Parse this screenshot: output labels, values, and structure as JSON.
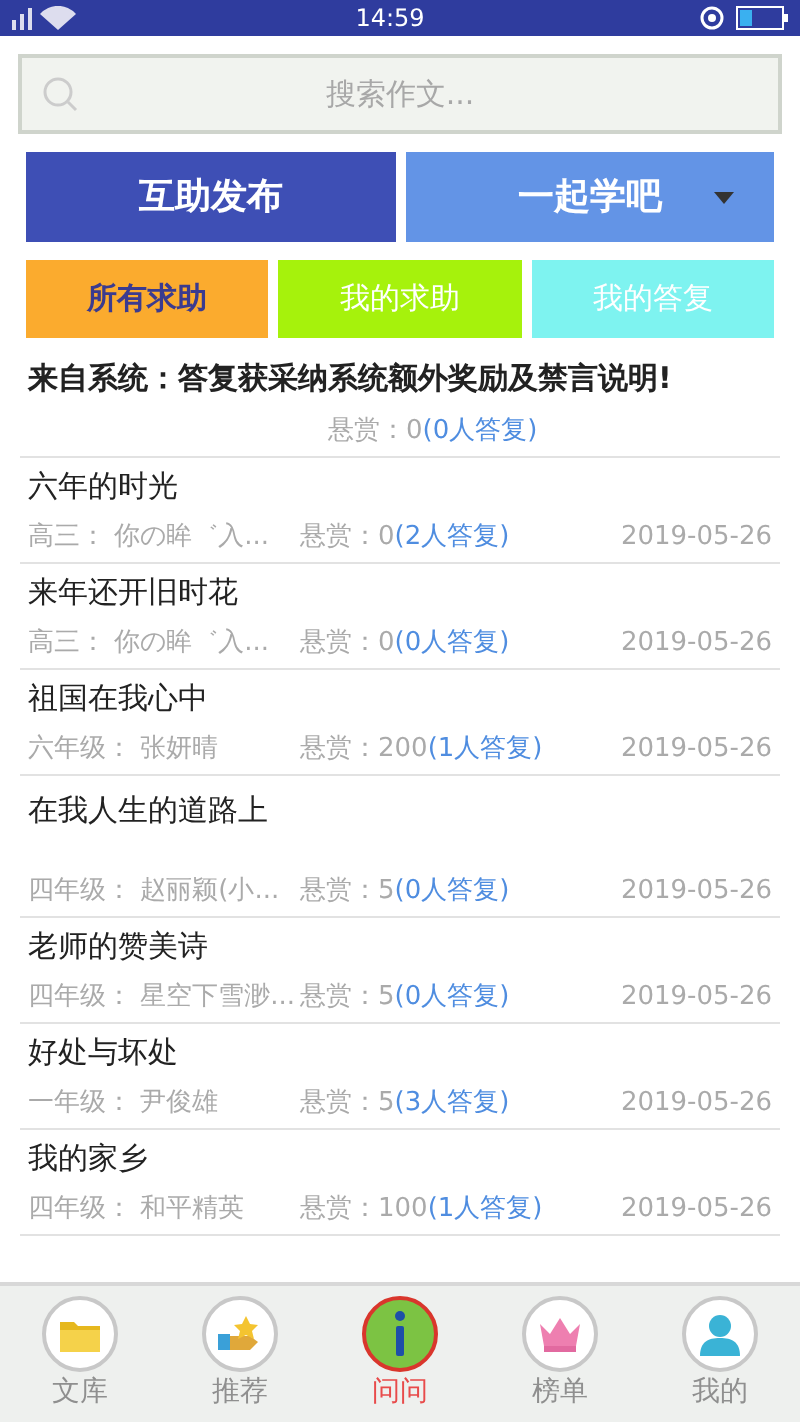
{
  "status_bar": {
    "time": "14:59"
  },
  "search": {
    "placeholder": "搜索作文..."
  },
  "actions": [
    {
      "label": "互助发布",
      "kind": "primary"
    },
    {
      "label": "一起学吧",
      "kind": "dropdown"
    }
  ],
  "filters": [
    {
      "label": "所有求助",
      "selected": true,
      "color": "#fbab2e"
    },
    {
      "label": "我的求助",
      "selected": false,
      "color": "#a6f20c"
    },
    {
      "label": "我的答复",
      "selected": false,
      "color": "#7ef3f0"
    }
  ],
  "posts": [
    {
      "kind": "system",
      "title": "来自系统：答复获采纳系统额外奖励及禁言说明!",
      "reward": "悬赏：0",
      "replies": "(0人答复)"
    },
    {
      "kind": "normal",
      "title": "六年的时光",
      "author": "高三： 你の眸゛入...",
      "reward": "悬赏：0",
      "replies": "(2人答复)",
      "date": "2019-05-26"
    },
    {
      "kind": "normal",
      "title": "来年还开旧时花",
      "author": "高三： 你の眸゛入...",
      "reward": "悬赏：0",
      "replies": "(0人答复)",
      "date": "2019-05-26"
    },
    {
      "kind": "normal",
      "title": "祖国在我心中",
      "author": "六年级： 张妍晴",
      "reward": "悬赏：200",
      "replies": "(1人答复)",
      "date": "2019-05-26"
    },
    {
      "kind": "tall",
      "title": "在我人生的道路上",
      "author": "四年级： 赵丽颖(小...",
      "reward": "悬赏：5",
      "replies": "(0人答复)",
      "date": "2019-05-26"
    },
    {
      "kind": "normal",
      "title": "老师的赞美诗",
      "author": "四年级： 星空下雪渺...",
      "reward": "悬赏：5",
      "replies": "(0人答复)",
      "date": "2019-05-26"
    },
    {
      "kind": "normal",
      "title": "好处与坏处",
      "author": "一年级： 尹俊雄",
      "reward": "悬赏：5",
      "replies": "(3人答复)",
      "date": "2019-05-26"
    },
    {
      "kind": "normal",
      "title": "我的家乡",
      "author": "四年级： 和平精英",
      "reward": "悬赏：100",
      "replies": "(1人答复)",
      "date": "2019-05-26"
    }
  ],
  "tab_bar": [
    {
      "label": "文库",
      "kind": "folder",
      "selected": false
    },
    {
      "label": "推荐",
      "kind": "star",
      "selected": false
    },
    {
      "label": "问问",
      "kind": "info",
      "selected": true
    },
    {
      "label": "榜单",
      "kind": "crown",
      "selected": false
    },
    {
      "label": "我的",
      "kind": "person",
      "selected": false
    }
  ]
}
